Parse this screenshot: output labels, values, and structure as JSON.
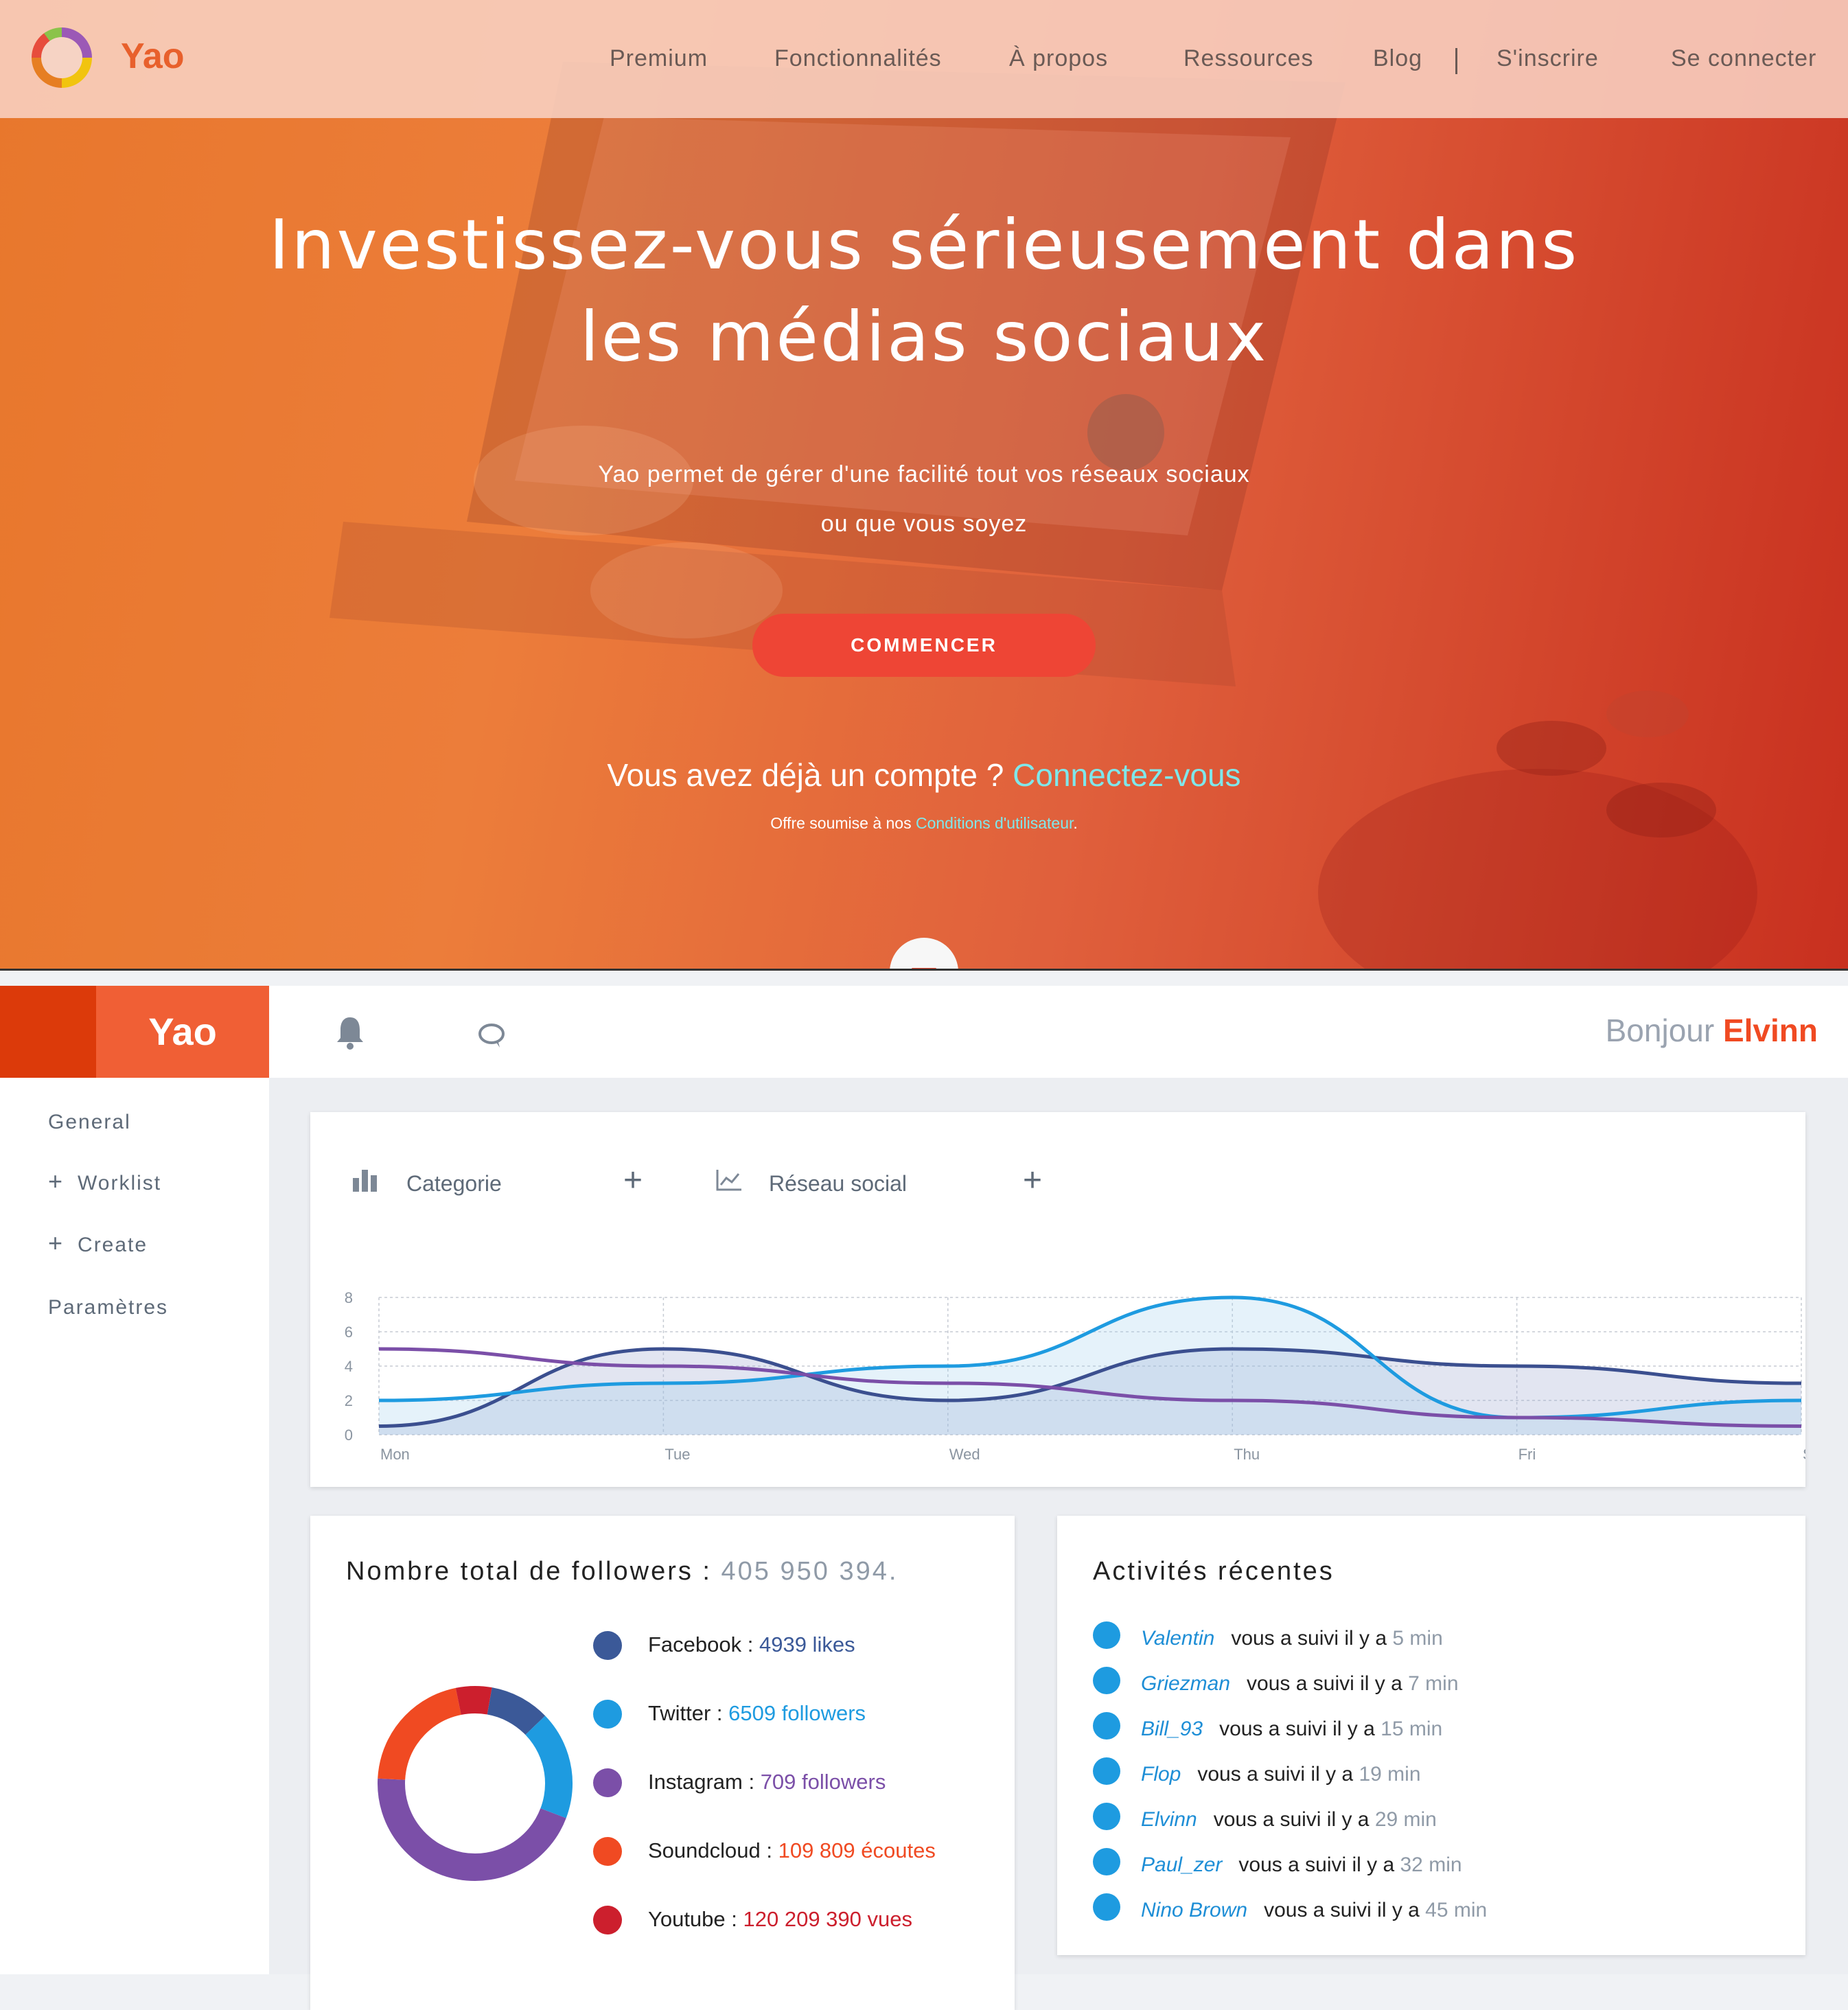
{
  "landing": {
    "logo": "Yao",
    "nav": [
      "Premium",
      "Fonctionnalités",
      "À propos",
      "Ressources",
      "Blog",
      "S'inscrire",
      "Se connecter"
    ],
    "hero_title_line1": "Investissez-vous sérieusement dans",
    "hero_title_line2": "les médias sociaux",
    "hero_sub_line1": "Yao permet de gérer d'une facilité tout vos réseaux sociaux",
    "hero_sub_line2": "ou que vous soyez",
    "cta": "COMMENCER",
    "account_text": "Vous avez déjà un compte ? ",
    "account_link": "Connectez-vous",
    "terms_text": "Offre soumise à nos ",
    "terms_link": "Conditions d'utilisateur",
    "terms_end": ".",
    "colors": {
      "accent": "#ee4535",
      "link": "#7fe7ea"
    }
  },
  "dashboard": {
    "logo": "Yao",
    "icons": [
      "bell-icon",
      "chat-icon",
      "bar-chart-icon",
      "line-chart-icon"
    ],
    "greeting": "Bonjour ",
    "user": "Elvinn",
    "sidebar": {
      "general": "General",
      "worklist": "Worklist",
      "create": "Create",
      "settings": "Paramètres",
      "plus": "+"
    },
    "tabs": {
      "category": "Categorie",
      "network": "Réseau social",
      "plus": "+"
    },
    "followers": {
      "title": "Nombre total de followers : ",
      "total": "405 950 394.",
      "items": [
        {
          "name": "Facebook :",
          "value": "4939 likes",
          "color": "#3b5998"
        },
        {
          "name": "Twitter :",
          "value": "6509 followers",
          "color": "#1e9be0"
        },
        {
          "name": "Instagram :",
          "value": "709 followers",
          "color": "#7b4fa8"
        },
        {
          "name": "Soundcloud :",
          "value": "109 809 écoutes",
          "color": "#f04a22"
        },
        {
          "name": "Youtube :",
          "value": "120 209 390 vues",
          "color": "#cc1f2d"
        }
      ],
      "donut_shares": [
        0.1,
        0.18,
        0.45,
        0.21,
        0.06
      ]
    },
    "activity": {
      "title": "Activités récentes",
      "rows": [
        {
          "name": "Valentin",
          "text": "vous a suivi il y a ",
          "time": "5 min"
        },
        {
          "name": "Griezman",
          "text": "vous a suivi il y a ",
          "time": "7 min"
        },
        {
          "name": "Bill_93",
          "text": "vous a suivi il y a ",
          "time": "15 min"
        },
        {
          "name": "Flop",
          "text": "vous a suivi il y a ",
          "time": "19 min"
        },
        {
          "name": "Elvinn",
          "text": "vous a suivi il y a ",
          "time": "29 min"
        },
        {
          "name": "Paul_zer",
          "text": "vous a suivi il y a ",
          "time": "32 min"
        },
        {
          "name": "Nino Brown",
          "text": "vous a suivi il y a ",
          "time": "45 min"
        }
      ]
    }
  },
  "chart_data": {
    "type": "line",
    "categories": [
      "Mon",
      "Tue",
      "Wed",
      "Thu",
      "Fri",
      "Sat"
    ],
    "ylim": [
      0,
      8
    ],
    "yticks": [
      0,
      2,
      4,
      6,
      8
    ],
    "grid": true,
    "series": [
      {
        "values": [
          0.5,
          5,
          2,
          5,
          4,
          3
        ],
        "color": "#3b4f8f",
        "fill": "rgba(160,170,210,0.30)"
      },
      {
        "values": [
          2,
          3,
          4,
          8,
          1,
          2
        ],
        "color": "#1e9be0",
        "fill": "rgba(150,205,235,0.25)"
      },
      {
        "values": [
          5,
          4,
          3,
          2,
          1,
          0.5
        ],
        "color": "#7b4fa8",
        "fill": "none"
      }
    ]
  }
}
